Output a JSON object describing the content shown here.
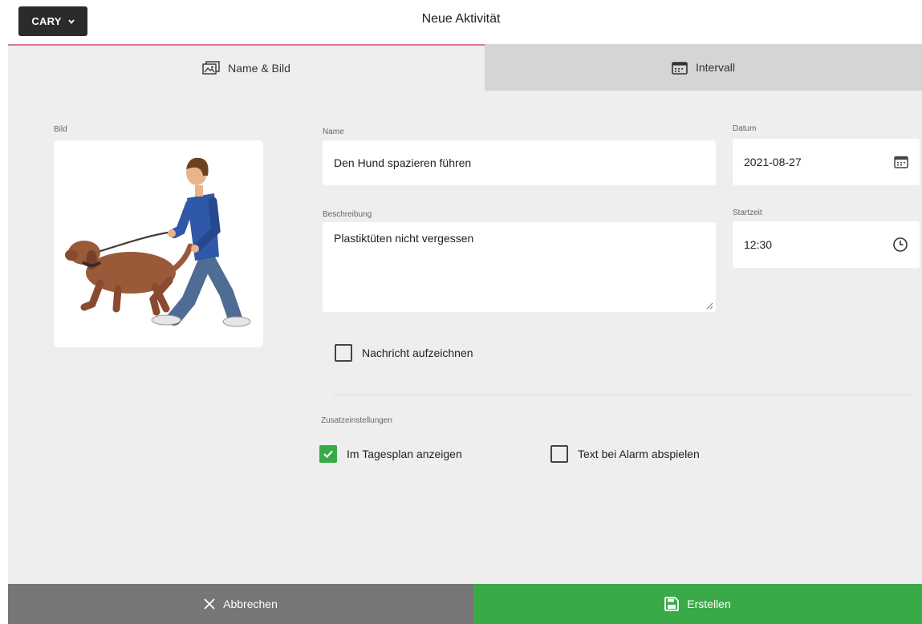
{
  "header": {
    "user_label": "CARY",
    "title": "Neue Aktivität"
  },
  "tabs": [
    {
      "label": "Name & Bild",
      "icon": "image-icon",
      "active": true
    },
    {
      "label": "Intervall",
      "icon": "calendar-icon",
      "active": false
    }
  ],
  "form": {
    "image_label": "Bild",
    "name_label": "Name",
    "name_value": "Den Hund spazieren führen",
    "description_label": "Beschreibung",
    "description_value": "Plastiktüten nicht vergessen",
    "date_label": "Datum",
    "date_value": "2021-08-27",
    "start_label": "Startzeit",
    "start_value": "12:30",
    "record_message_label": "Nachricht aufzeichnen",
    "extra_settings_label": "Zusatzeinstellungen",
    "show_in_plan_label": "Im Tagesplan anzeigen",
    "show_in_plan_checked": true,
    "alarm_text_label": "Text bei Alarm abspielen",
    "alarm_text_checked": false
  },
  "footer": {
    "cancel_label": "Abbrechen",
    "create_label": "Erstellen"
  },
  "colors": {
    "tab_accent": "#e07a96",
    "success": "#3aaa48",
    "cancel": "#767676"
  }
}
